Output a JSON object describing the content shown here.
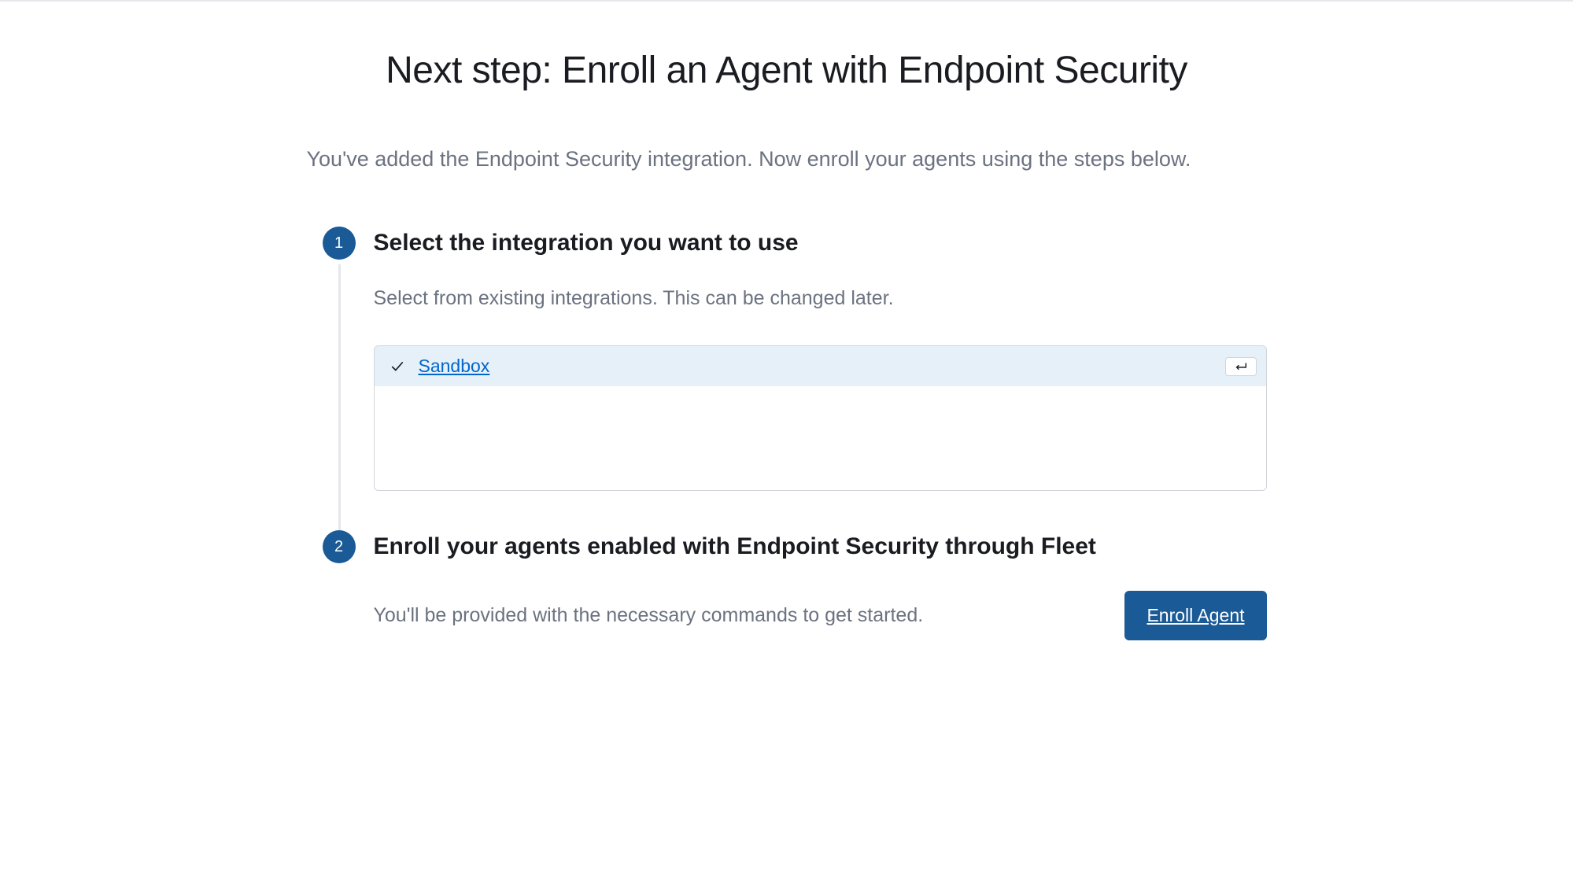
{
  "header": {
    "title": "Next step: Enroll an Agent with Endpoint Security",
    "subtitle": "You've added the Endpoint Security integration. Now enroll your agents using the steps below."
  },
  "steps": [
    {
      "number": "1",
      "title": "Select the integration you want to use",
      "description": "Select from existing integrations. This can be changed later.",
      "options": [
        {
          "label": "Sandbox",
          "selected": true
        }
      ]
    },
    {
      "number": "2",
      "title": "Enroll your agents enabled with Endpoint Security through Fleet",
      "description": "You'll be provided with the necessary commands to get started.",
      "button_label": "Enroll Agent"
    }
  ]
}
